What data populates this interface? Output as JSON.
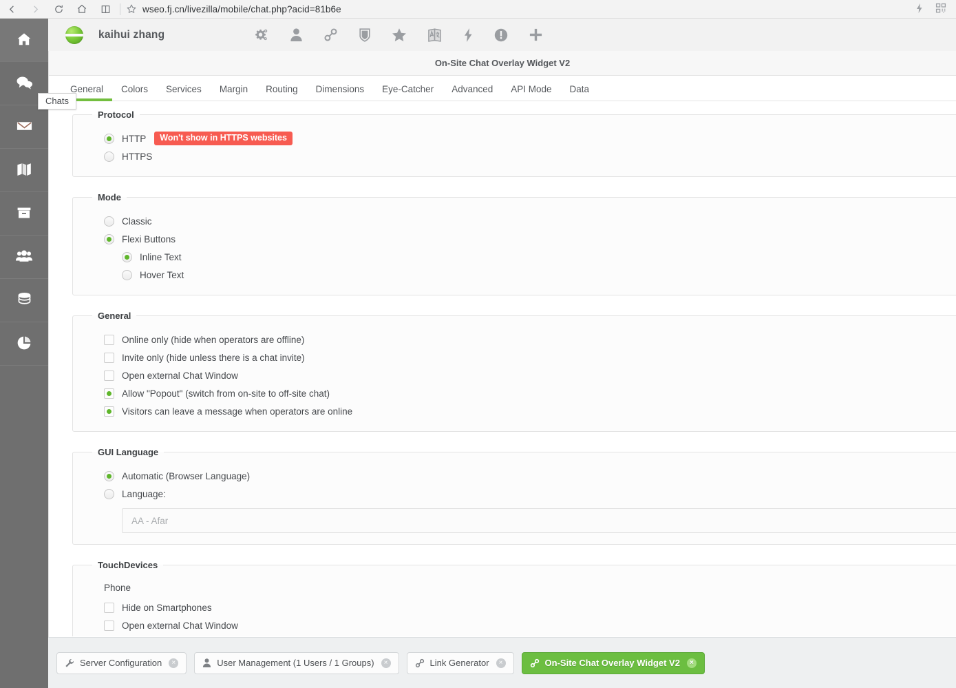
{
  "browser": {
    "back_icon": "chevron-left-icon",
    "forward_icon": "chevron-right-icon",
    "reload_icon": "reload-icon",
    "home_icon": "home-icon",
    "reading_list_icon": "book-icon",
    "bookmark_icon": "star-icon",
    "url": "wseo.fj.cn/livezilla/mobile/chat.php?acid=81b6e",
    "right_icons": [
      "lightning-icon",
      "qr-code-icon"
    ]
  },
  "sidebar": {
    "items": [
      {
        "name": "home",
        "icon": "home-icon",
        "label": "Home"
      },
      {
        "name": "chats",
        "icon": "chat-bubbles-icon",
        "label": "Chats"
      },
      {
        "name": "mail",
        "icon": "envelope-icon",
        "label": "Mail"
      },
      {
        "name": "map",
        "icon": "map-icon",
        "label": "Map"
      },
      {
        "name": "archive",
        "icon": "archive-box-icon",
        "label": "Archive"
      },
      {
        "name": "visitors",
        "icon": "users-group-icon",
        "label": "Visitors"
      },
      {
        "name": "database",
        "icon": "database-icon",
        "label": "Database"
      },
      {
        "name": "reports",
        "icon": "pie-chart-icon",
        "label": "Reports"
      }
    ],
    "tooltip": "Chats"
  },
  "topbar": {
    "logo": "livezilla-logo",
    "user_name": "kaihui zhang",
    "icons": [
      {
        "name": "settings-gears-icon"
      },
      {
        "name": "user-icon"
      },
      {
        "name": "link-chain-icon"
      },
      {
        "name": "shield-icon"
      },
      {
        "name": "star-icon"
      },
      {
        "name": "translate-icon"
      },
      {
        "name": "lightning-icon"
      },
      {
        "name": "info-circle-icon"
      },
      {
        "name": "plus-icon"
      }
    ]
  },
  "panel": {
    "title": "On-Site Chat Overlay Widget V2",
    "tabs": [
      {
        "label": "General",
        "active": true
      },
      {
        "label": "Colors",
        "active": false
      },
      {
        "label": "Services",
        "active": false
      },
      {
        "label": "Margin",
        "active": false
      },
      {
        "label": "Routing",
        "active": false
      },
      {
        "label": "Dimensions",
        "active": false
      },
      {
        "label": "Eye-Catcher",
        "active": false
      },
      {
        "label": "Advanced",
        "active": false
      },
      {
        "label": "API Mode",
        "active": false
      },
      {
        "label": "Data",
        "active": false
      }
    ]
  },
  "protocol": {
    "legend": "Protocol",
    "options": [
      {
        "label": "HTTP",
        "checked": true,
        "badge": "Won't show in HTTPS websites"
      },
      {
        "label": "HTTPS",
        "checked": false,
        "badge": ""
      }
    ]
  },
  "mode": {
    "legend": "Mode",
    "options": [
      {
        "label": "Classic",
        "checked": false
      },
      {
        "label": "Flexi Buttons",
        "checked": true
      }
    ],
    "sub_options": [
      {
        "label": "Inline Text",
        "checked": true
      },
      {
        "label": "Hover Text",
        "checked": false
      }
    ]
  },
  "general": {
    "legend": "General",
    "options": [
      {
        "label": "Online only (hide when operators are offline)",
        "checked": false
      },
      {
        "label": "Invite only (hide unless there is a chat invite)",
        "checked": false
      },
      {
        "label": "Open external Chat Window",
        "checked": false
      },
      {
        "label": "Allow \"Popout\" (switch from on-site to off-site chat)",
        "checked": true
      },
      {
        "label": "Visitors can leave a message when operators are online",
        "checked": true
      }
    ]
  },
  "gui_language": {
    "legend": "GUI Language",
    "options": [
      {
        "label": "Automatic (Browser Language)",
        "checked": true
      },
      {
        "label": "Language:",
        "checked": false
      }
    ],
    "select_value": "AA - Afar"
  },
  "touch_devices": {
    "legend": "TouchDevices",
    "group_label": "Phone",
    "options": [
      {
        "label": "Hide on Smartphones",
        "checked": false
      },
      {
        "label": "Open external Chat Window",
        "checked": false
      }
    ]
  },
  "taskbar": {
    "items": [
      {
        "label": "Server Configuration",
        "icon": "wrench-icon",
        "active": false,
        "close": "×"
      },
      {
        "label": "User Management (1 Users / 1 Groups)",
        "icon": "user-icon",
        "active": false,
        "close": "×"
      },
      {
        "label": "Link Generator",
        "icon": "link-chain-icon",
        "active": false,
        "close": "×"
      },
      {
        "label": "On-Site Chat Overlay Widget V2",
        "icon": "link-chain-icon",
        "active": true,
        "close": "×"
      }
    ]
  },
  "colors": {
    "accent_green": "#6cbe41",
    "tab_underline": "#73be3e",
    "badge_red": "#f75b51",
    "sidebar_gray": "#6f6f6f",
    "topbar_gray": "#f2f2f2"
  }
}
